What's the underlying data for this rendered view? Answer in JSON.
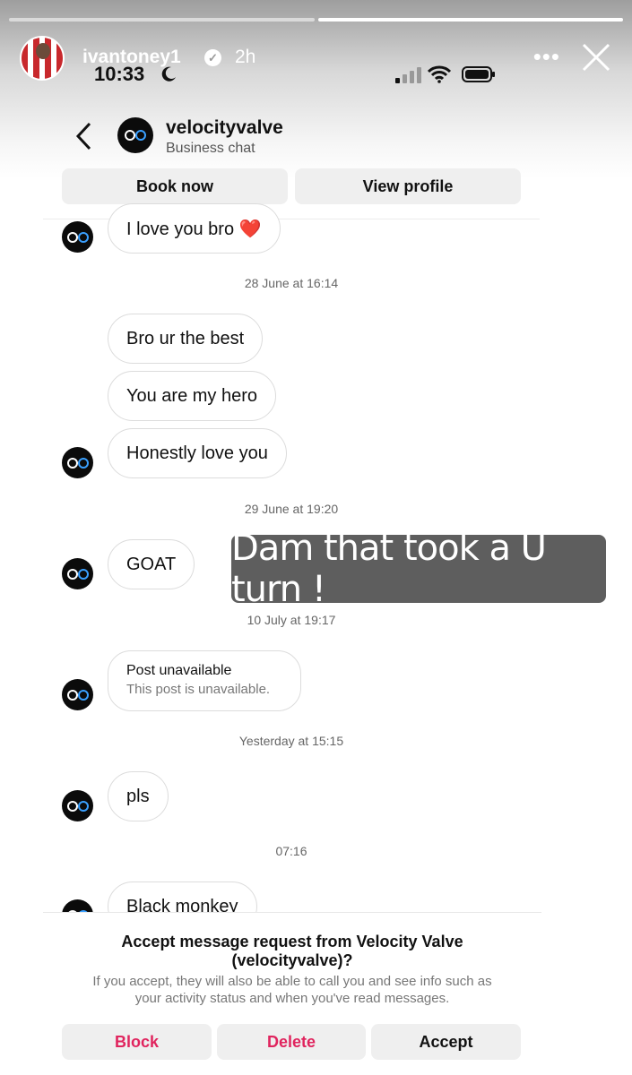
{
  "story": {
    "username": "ivantoney1",
    "age": "2h",
    "status_time": "10:33",
    "progress_segments": 2,
    "active_segment": 0
  },
  "chat_header": {
    "name": "velocityvalve",
    "subtitle": "Business chat",
    "book_label": "Book now",
    "profile_label": "View profile"
  },
  "messages": [
    {
      "text": "I love you bro ❤️"
    },
    {
      "timestamp": "28 June at 16:14"
    },
    {
      "text": "Bro ur the best"
    },
    {
      "text": "You are my hero"
    },
    {
      "text": "Honestly love you"
    },
    {
      "timestamp": "29 June at 19:20"
    },
    {
      "text": "GOAT"
    },
    {
      "timestamp": "10 July at 19:17"
    },
    {
      "post_title": "Post unavailable",
      "post_sub": "This post is unavailable."
    },
    {
      "timestamp": "Yesterday at 15:15"
    },
    {
      "text": "pls"
    },
    {
      "timestamp": "07:16"
    },
    {
      "text": "Black monkey"
    }
  ],
  "overlay_caption": "Dam that took a U turn !",
  "request": {
    "title_line1": "Accept message request from Velocity Valve",
    "title_line2": "(velocityvalve)?",
    "desc_line1": "If you accept, they will also be able to call you and see info such as",
    "desc_line2": "your activity status and when you've read messages.",
    "block_label": "Block",
    "delete_label": "Delete",
    "accept_label": "Accept"
  },
  "colors": {
    "destructive": "#e0245e",
    "caption_bg": "#5e5e5e",
    "bubble_border": "#dcdcdc",
    "button_bg": "#efefef"
  }
}
